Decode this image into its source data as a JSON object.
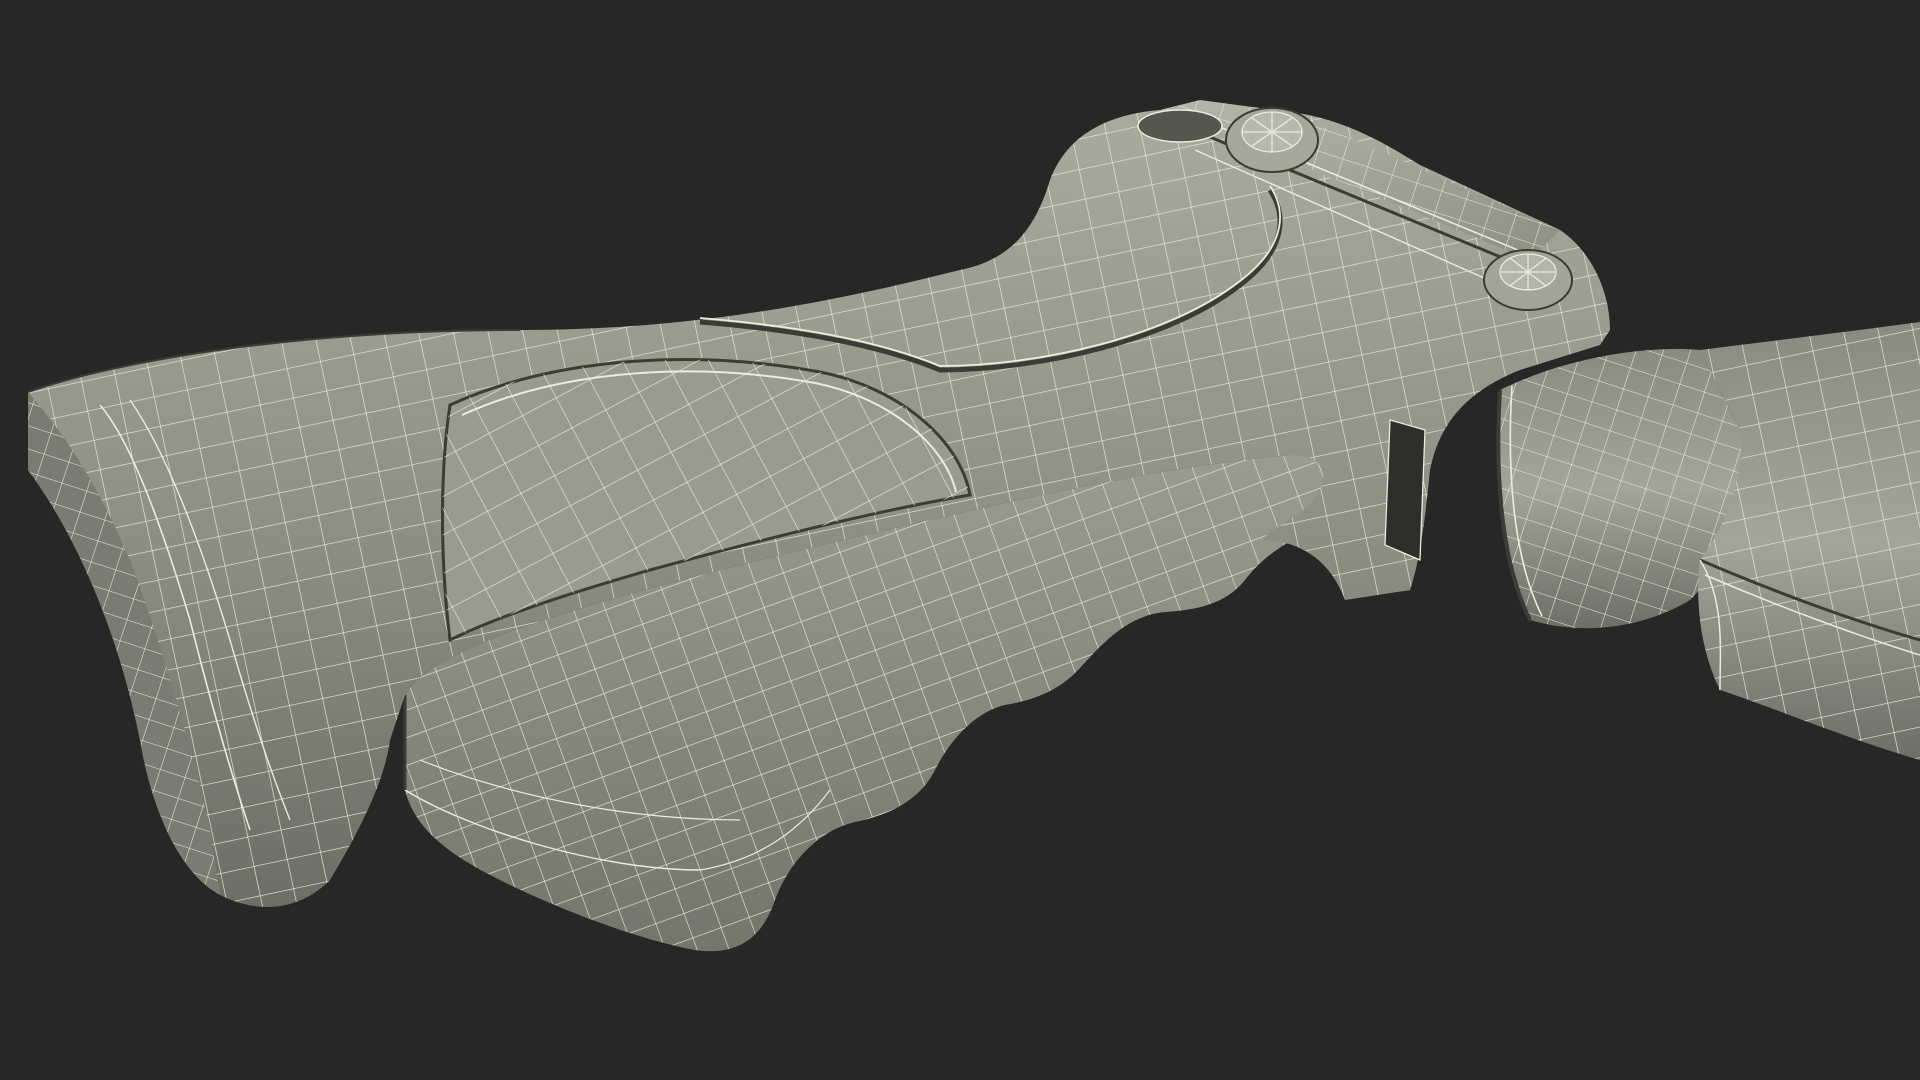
{
  "scene": {
    "subject": "wireframe-grip",
    "colors": {
      "background": "#272727",
      "model_base": "#8f9083",
      "model_light": "#b4b5a7",
      "model_shadow": "#5d5e55",
      "wire": "#ecebdc",
      "wire_dark": "#3b3c36"
    }
  }
}
